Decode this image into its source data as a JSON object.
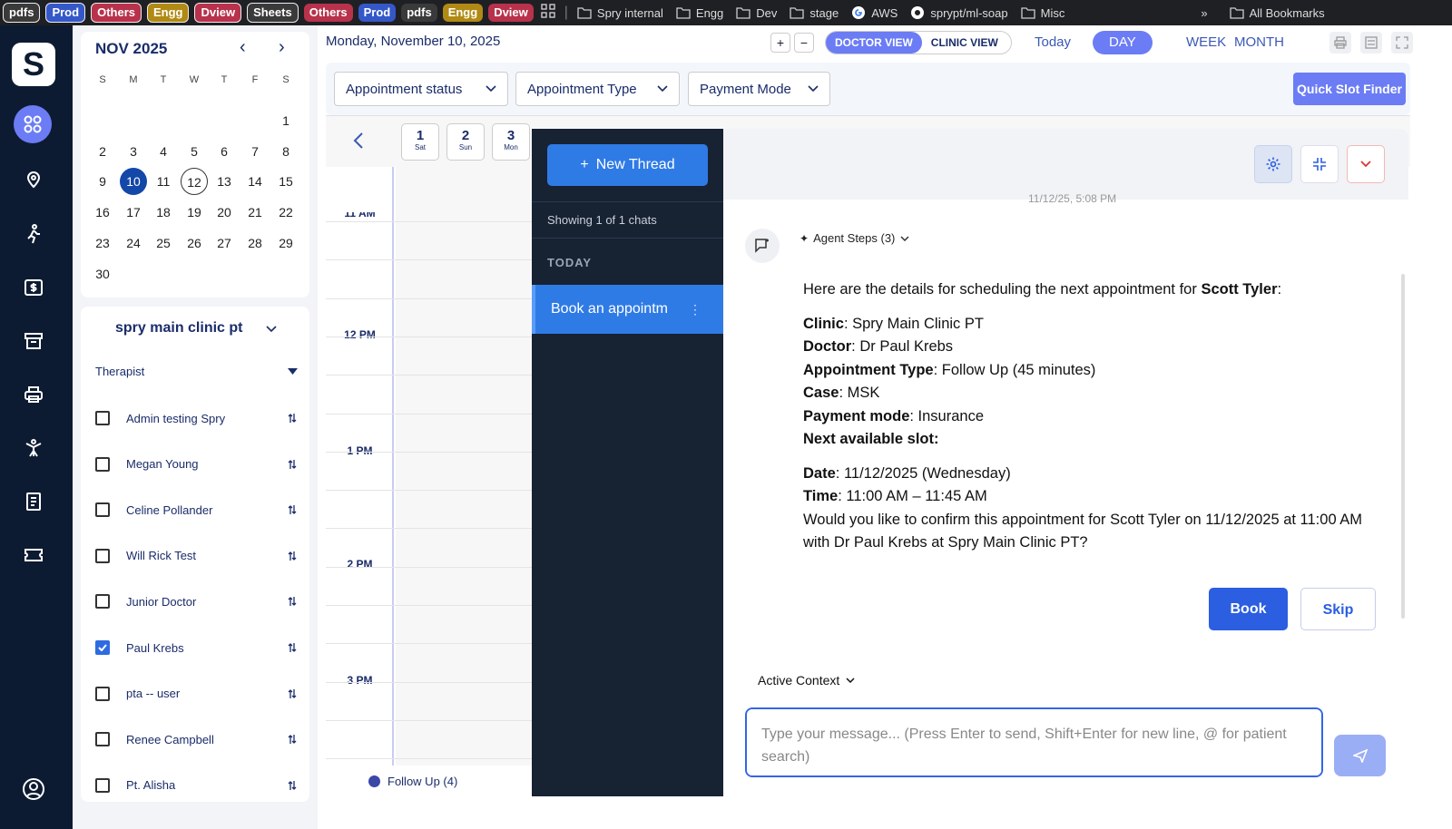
{
  "bookmarks": {
    "tags": [
      {
        "label": "pdfs",
        "color": "#3a3a3a",
        "outlined": true
      },
      {
        "label": "Prod",
        "color": "#3558c9",
        "outlined": true
      },
      {
        "label": "Others",
        "color": "#b8324c",
        "outlined": true
      },
      {
        "label": "Engg",
        "color": "#b08a14",
        "outlined": true
      },
      {
        "label": "Dview",
        "color": "#b8324c",
        "outlined": true
      },
      {
        "label": "Sheets",
        "color": "#3a3a3a",
        "outlined": true
      },
      {
        "label": "Others",
        "color": "#b8324c",
        "outlined": false
      },
      {
        "label": "Prod",
        "color": "#3558c9",
        "outlined": false
      },
      {
        "label": "pdfs",
        "color": "#3a3a3a",
        "outlined": false
      },
      {
        "label": "Engg",
        "color": "#b08a14",
        "outlined": false
      },
      {
        "label": "Dview",
        "color": "#b8324c",
        "outlined": false
      }
    ],
    "folders": [
      "Spry internal",
      "Engg",
      "Dev",
      "stage"
    ],
    "aws": "AWS",
    "github": "sprypt/ml-soap",
    "misc": "Misc",
    "more": "»",
    "all": "All Bookmarks"
  },
  "sidebar": {
    "logo": "S"
  },
  "calendar": {
    "month": "NOV 2025",
    "prev": "‹",
    "next": "›",
    "weekdays": [
      "S",
      "M",
      "T",
      "W",
      "T",
      "F",
      "S"
    ],
    "first_weekday": 6,
    "days_in_month": 30,
    "selected_day": 10,
    "today_day": 12
  },
  "therapists": {
    "clinic": "spry main clinic pt",
    "label": "Therapist",
    "items": [
      {
        "name": "Admin testing Spry",
        "checked": false
      },
      {
        "name": "Megan Young",
        "checked": false
      },
      {
        "name": "Celine Pollander",
        "checked": false
      },
      {
        "name": "Will Rick Test",
        "checked": false
      },
      {
        "name": "Junior Doctor",
        "checked": false
      },
      {
        "name": "Paul Krebs",
        "checked": true
      },
      {
        "name": "pta -- user",
        "checked": false
      },
      {
        "name": "Renee Campbell",
        "checked": false
      },
      {
        "name": "Pt. Alisha",
        "checked": false
      }
    ]
  },
  "header": {
    "date": "Monday, November 10, 2025",
    "zoom_in": "+",
    "zoom_out": "−",
    "doctor_view": "DOCTOR VIEW",
    "clinic_view": "CLINIC VIEW",
    "today": "Today",
    "day": "DAY",
    "week": "WEEK",
    "month": "MONTH"
  },
  "filters": {
    "appointment_status": "Appointment status",
    "appointment_type": "Appointment Type",
    "payment_mode": "Payment Mode",
    "quick_slot": "Quick Slot Finder"
  },
  "day_strip": [
    {
      "num": "1",
      "dow": "Sat"
    },
    {
      "num": "2",
      "dow": "Sun"
    },
    {
      "num": "3",
      "dow": "Mon"
    }
  ],
  "time_labels": [
    "11 AM",
    "12 PM",
    "1 PM",
    "2 PM",
    "3 PM"
  ],
  "legend": {
    "follow_up": "Follow Up (4)"
  },
  "chat_list": {
    "new_thread": "New Thread",
    "showing": "Showing 1 of 1 chats",
    "group": "TODAY",
    "item": "Book an appointm"
  },
  "chat": {
    "timestamp": "11/12/25, 5:08 PM",
    "agent_steps": "Agent Steps (3)",
    "intro_pre": "Here are the details for scheduling the next appointment for ",
    "intro_name": "Scott Tyler",
    "intro_post": ":",
    "details": [
      {
        "label": "Clinic",
        "value": "Spry Main Clinic PT"
      },
      {
        "label": "Doctor",
        "value": "Dr Paul Krebs"
      },
      {
        "label": "Appointment Type",
        "value": "Follow Up (45 minutes)"
      },
      {
        "label": "Case",
        "value": "MSK"
      },
      {
        "label": "Payment mode",
        "value": "Insurance"
      }
    ],
    "next_slot": "Next available slot:",
    "slot": [
      {
        "label": "Date",
        "value": "11/12/2025 (Wednesday)"
      },
      {
        "label": "Time",
        "value": "11:00 AM – 11:45 AM"
      }
    ],
    "question": "Would you like to confirm this appointment for Scott Tyler on 11/12/2025 at 11:00 AM with Dr Paul Krebs at Spry Main Clinic PT?",
    "book": "Book",
    "skip": "Skip",
    "active_context": "Active Context",
    "input_placeholder": "Type your message... (Press Enter to send, Shift+Enter for new line, @ for patient search)"
  }
}
